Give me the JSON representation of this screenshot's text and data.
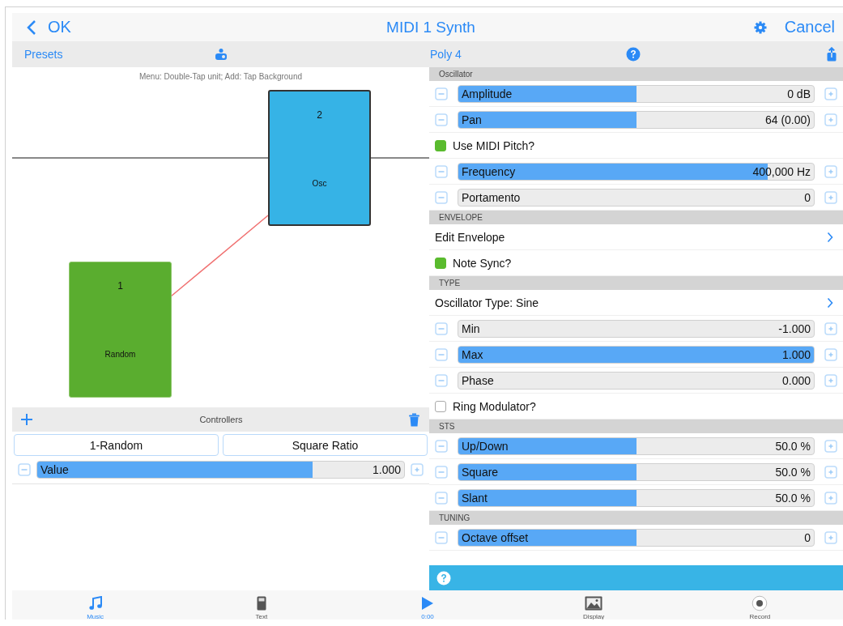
{
  "nav": {
    "back": "OK",
    "title": "MIDI 1 Synth",
    "cancel": "Cancel"
  },
  "left_toolbar": {
    "presets": "Presets"
  },
  "canvas": {
    "hint": "Menu: Double-Tap unit; Add: Tap Background",
    "units": [
      {
        "number": "2",
        "name": "Osc",
        "color": "#36b3e6",
        "selected": true
      },
      {
        "number": "1",
        "name": "Random",
        "color": "#5aad2f",
        "selected": false
      }
    ]
  },
  "controllers": {
    "title": "Controllers",
    "buttons": [
      "1-Random",
      "Square Ratio"
    ],
    "slider": {
      "label": "Value",
      "value": "1.000",
      "level": 0.75
    }
  },
  "right_toolbar": {
    "title": "Poly 4"
  },
  "sections": [
    {
      "header": "Oscillator",
      "rows": [
        {
          "kind": "slider",
          "label": "Amplitude",
          "value": "0 dB",
          "level": 0.5
        },
        {
          "kind": "slider",
          "label": "Pan",
          "value": "64 (0.00)",
          "level": 0.5
        },
        {
          "kind": "check",
          "label": "Use MIDI Pitch?",
          "checked": true
        },
        {
          "kind": "slider",
          "label": "Frequency",
          "value": "400,000 Hz",
          "level": 0.87
        },
        {
          "kind": "slider",
          "label": "Portamento",
          "value": "0",
          "level": 0
        }
      ]
    },
    {
      "header": "ENVELOPE",
      "rows": [
        {
          "kind": "link",
          "label": "Edit Envelope"
        },
        {
          "kind": "check",
          "label": "Note Sync?",
          "checked": true
        }
      ]
    },
    {
      "header": "TYPE",
      "rows": [
        {
          "kind": "link",
          "label": "Oscillator Type: Sine"
        },
        {
          "kind": "slider",
          "label": "Min",
          "value": "-1.000",
          "level": 0
        },
        {
          "kind": "slider",
          "label": "Max",
          "value": "1.000",
          "level": 1
        },
        {
          "kind": "slider",
          "label": "Phase",
          "value": "0.000",
          "level": 0
        },
        {
          "kind": "check",
          "label": "Ring Modulator?",
          "checked": false
        }
      ]
    },
    {
      "header": "STS",
      "rows": [
        {
          "kind": "slider",
          "label": "Up/Down",
          "value": "50.0 %",
          "level": 0.5
        },
        {
          "kind": "slider",
          "label": "Square",
          "value": "50.0 %",
          "level": 0.5
        },
        {
          "kind": "slider",
          "label": "Slant",
          "value": "50.0 %",
          "level": 0.5
        }
      ]
    },
    {
      "header": "TUNING",
      "rows": [
        {
          "kind": "slider",
          "label": "Octave offset",
          "value": "0",
          "level": 0.5
        }
      ]
    }
  ],
  "player": {
    "time": "0:00"
  },
  "tabs": [
    {
      "kind": "music",
      "label": "Music",
      "selected": true
    },
    {
      "kind": "text",
      "label": "Text",
      "selected": false
    },
    {
      "kind": "display",
      "label": "Display",
      "selected": false
    },
    {
      "kind": "record",
      "label": "Record",
      "selected": false
    }
  ]
}
